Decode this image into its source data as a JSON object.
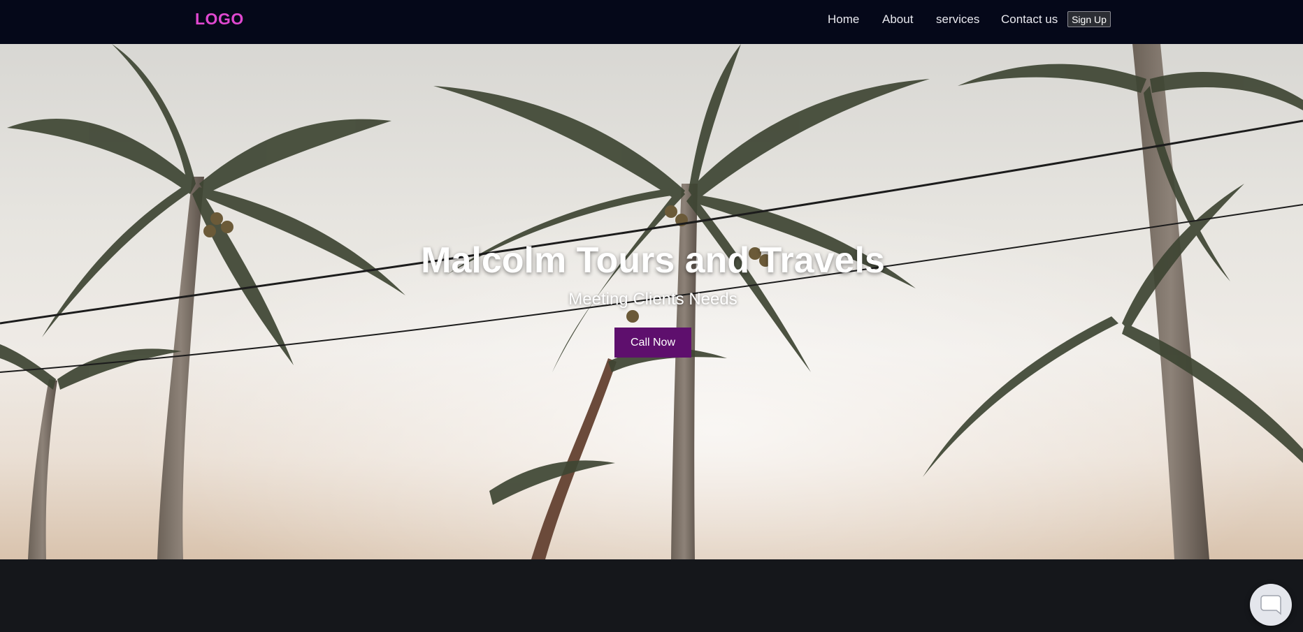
{
  "nav": {
    "logo": "LOGO",
    "links": [
      "Home",
      "About",
      "services",
      "Contact us"
    ],
    "signup_label": "Sign Up"
  },
  "hero": {
    "title": "Malcolm Tours and Travels",
    "subtitle": "Meeting Clients Needs",
    "cta_label": "Call Now",
    "background_image": "palm-trees-photo"
  },
  "chat": {
    "icon": "chat-bubble-icon"
  },
  "colors": {
    "navbar_bg": "#050819",
    "logo": "#e048d0",
    "cta_bg": "#5e0f6d",
    "footer_bg": "#15171b"
  }
}
